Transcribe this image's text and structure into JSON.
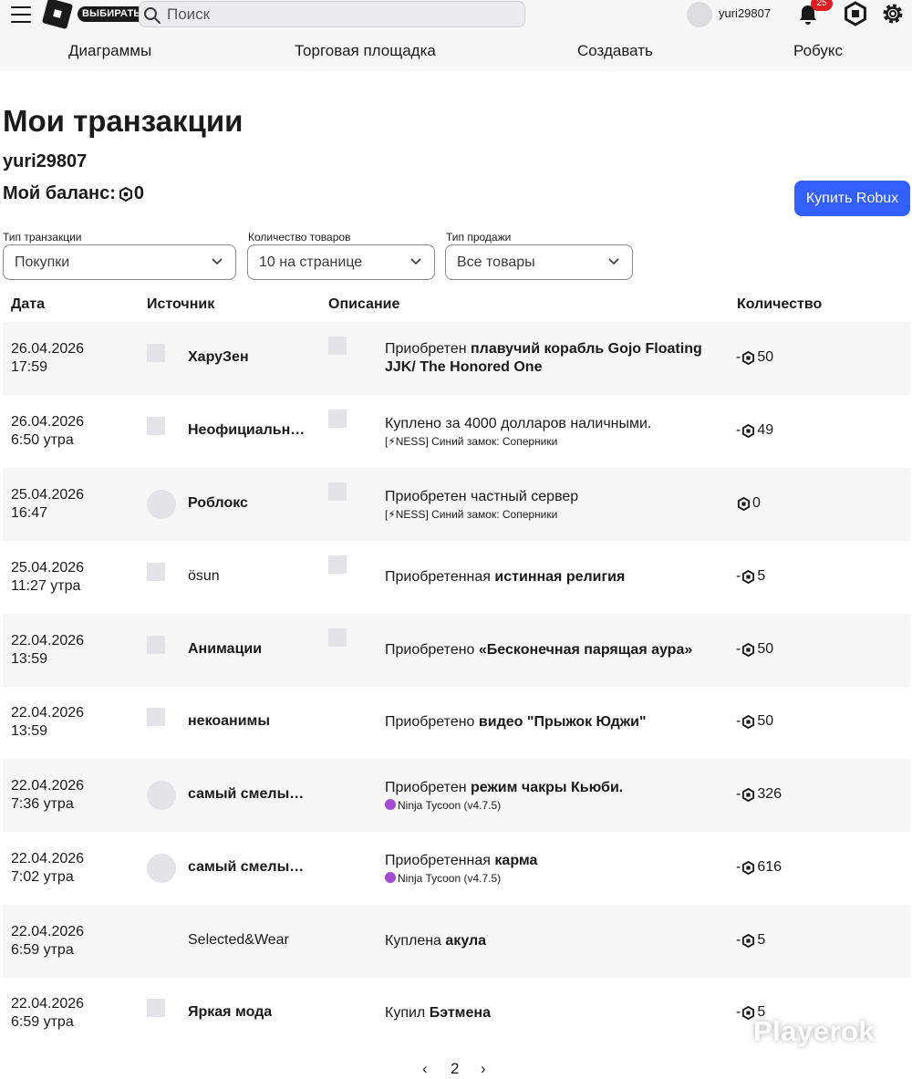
{
  "header": {
    "choose_badge": "ВЫБИРАТЬ",
    "search_placeholder": "Поиск",
    "username": "yuri29807",
    "notifications_count": "25",
    "nav": [
      "Диаграммы",
      "Торговая площадка",
      "Создавать",
      "Робукс"
    ]
  },
  "page": {
    "title": "Мои транзакции",
    "username": "yuri29807",
    "balance_label": "Мой баланс:",
    "balance_value": "0",
    "buy_button": "Купить Robux"
  },
  "filters": [
    {
      "label": "Тип транзакции",
      "value": "Покупки"
    },
    {
      "label": "Количество товаров",
      "value": "10 на странице"
    },
    {
      "label": "Тип продажи",
      "value": "Все товары"
    }
  ],
  "table": {
    "headers": [
      "Дата",
      "Источник",
      "Описание",
      "Количество"
    ],
    "rows": [
      {
        "date": "26.04.2026",
        "time": "17:59",
        "source": "ХаруЗен",
        "desc_pre": "Приобретен",
        "desc_item": "плавучий корабль Gojo Floating JJK/ The Honored One",
        "desc_sub": "",
        "amount": "50",
        "sign": "-"
      },
      {
        "date": "26.04.2026",
        "time": "6:50 утра",
        "source": "Неофициальный магазин",
        "desc_pre": "Куплено за 4000 долларов наличными.",
        "desc_item": "",
        "desc_sub": "[⚡NESS] Синий замок: Соперники",
        "amount": "49",
        "sign": "-"
      },
      {
        "date": "25.04.2026",
        "time": "16:47",
        "source": "Роблокс",
        "desc_pre": "Приобретен частный сервер",
        "desc_item": "",
        "desc_sub": "[⚡NESS] Синий замок: Соперники",
        "amount": "0",
        "sign": ""
      },
      {
        "date": "25.04.2026",
        "time": "11:27 утра",
        "source": "ösun",
        "desc_pre": "Приобретенная",
        "desc_item": "истинная религия",
        "desc_sub": "",
        "amount": "5",
        "sign": "-"
      },
      {
        "date": "22.04.2026",
        "time": "13:59",
        "source": "Анимации",
        "desc_pre": "Приобретено",
        "desc_item": "«Бесконечная парящая аура»",
        "desc_sub": "",
        "amount": "50",
        "sign": "-"
      },
      {
        "date": "22.04.2026",
        "time": "13:59",
        "source": "некоанимы",
        "desc_pre": "Приобретено",
        "desc_item": "видео \"Прыжок Юджи\"",
        "desc_sub": "",
        "amount": "50",
        "sign": "-"
      },
      {
        "date": "22.04.2026",
        "time": "7:36 утра",
        "source": "самый смелый ниндзя",
        "desc_pre": "Приобретен",
        "desc_item": "режим чакры Кьюби.",
        "desc_sub": "Ninja Tycoon (v4.7.5)",
        "amount": "326",
        "sign": "-"
      },
      {
        "date": "22.04.2026",
        "time": "7:02 утра",
        "source": "самый смелый ниндзя",
        "desc_pre": "Приобретенная",
        "desc_item": "карма",
        "desc_sub": "Ninja Tycoon (v4.7.5)",
        "amount": "616",
        "sign": "-"
      },
      {
        "date": "22.04.2026",
        "time": "6:59 утра",
        "source": "Selected&Wear",
        "desc_pre": "Куплена",
        "desc_item": "акула",
        "desc_sub": "",
        "amount": "5",
        "sign": "-"
      },
      {
        "date": "22.04.2026",
        "time": "6:59 утра",
        "source": "Яркая мода",
        "desc_pre": "Купил",
        "desc_item": "Бэтмена",
        "desc_sub": "",
        "amount": "5",
        "sign": "-"
      }
    ]
  },
  "pager": {
    "current": "2",
    "prev": "‹",
    "next": "›"
  },
  "watermark": "Playerok",
  "colors": {
    "accent": "#335fff",
    "badge": "#e11d21",
    "row_alt": "#f7f7f8"
  }
}
